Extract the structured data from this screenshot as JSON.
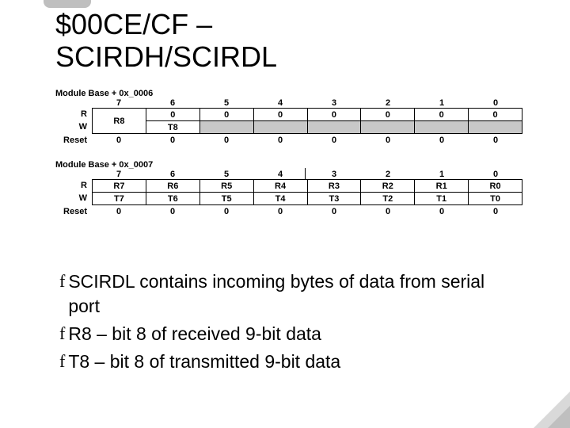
{
  "title_line1": "$00CE/CF –",
  "title_line2": "SCIRDH/SCIRDL",
  "reg1": {
    "module_base": "Module Base + 0x_0006",
    "bits": [
      "7",
      "6",
      "5",
      "4",
      "3",
      "2",
      "1",
      "0"
    ],
    "rlabel": "R",
    "wlabel": "W",
    "resetlabel": "Reset",
    "r_row": [
      "R8",
      "0",
      "0",
      "0",
      "0",
      "0",
      "0",
      "0"
    ],
    "w_left": "T8",
    "reset": [
      "0",
      "0",
      "0",
      "0",
      "0",
      "0",
      "0",
      "0"
    ]
  },
  "reg2": {
    "module_base": "Module Base + 0x_0007",
    "bits": [
      "7",
      "6",
      "5",
      "4",
      "3",
      "2",
      "1",
      "0"
    ],
    "rlabel": "R",
    "wlabel": "W",
    "resetlabel": "Reset",
    "r_row": [
      "R7",
      "R6",
      "R5",
      "R4",
      "R3",
      "R2",
      "R1",
      "R0"
    ],
    "w_row": [
      "T7",
      "T6",
      "T5",
      "T4",
      "T3",
      "T2",
      "T1",
      "T0"
    ],
    "reset": [
      "0",
      "0",
      "0",
      "0",
      "0",
      "0",
      "0",
      "0"
    ]
  },
  "bullets": [
    "SCIRDL contains incoming bytes of data from serial port",
    "R8 – bit 8 of received 9-bit data",
    "T8 – bit 8 of transmitted 9-bit data"
  ],
  "bullet_marker": "f"
}
